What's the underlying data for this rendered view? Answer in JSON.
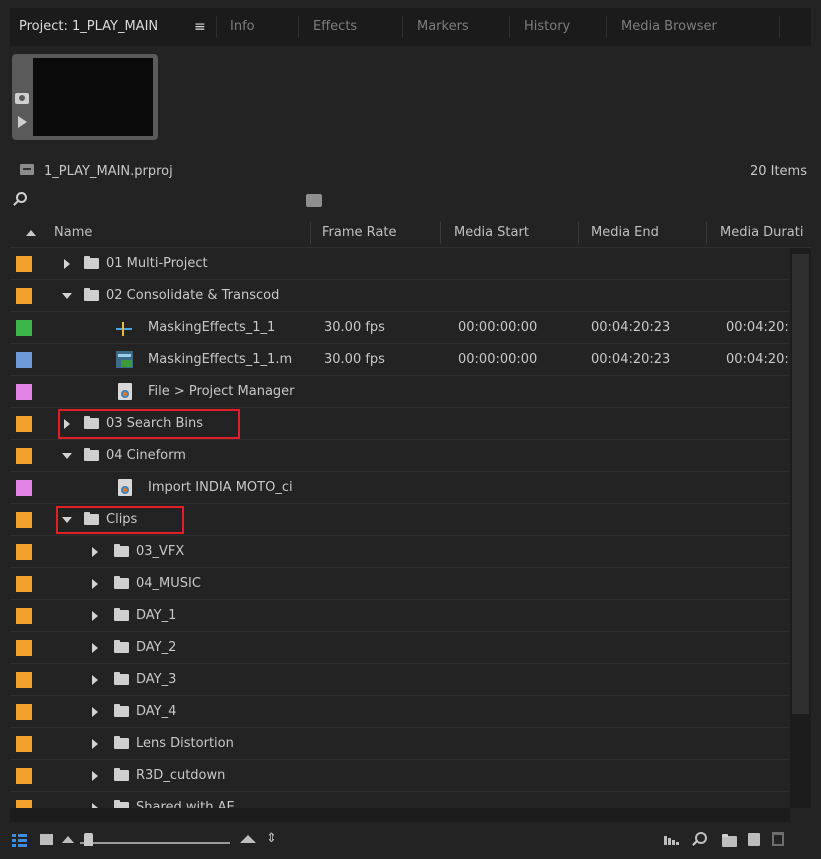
{
  "tabs": [
    {
      "label": "Project: 1_PLAY_MAIN",
      "active": true
    },
    {
      "label": "Info"
    },
    {
      "label": "Effects"
    },
    {
      "label": "Markers"
    },
    {
      "label": "History"
    },
    {
      "label": "Media Browser"
    }
  ],
  "panel_menu_glyph": "≡",
  "project": {
    "file_name": "1_PLAY_MAIN.prproj",
    "item_count": "20 Items"
  },
  "search": {
    "placeholder": ""
  },
  "columns": {
    "name": "Name",
    "frame_rate": "Frame Rate",
    "media_start": "Media Start",
    "media_end": "Media End",
    "media_duration": "Media Durati"
  },
  "rows": [
    {
      "name": "01 Multi-Project",
      "type": "folder",
      "expanded": false,
      "label_color": "#f2a12c"
    },
    {
      "name": "02 Consolidate & Transcod",
      "type": "folder",
      "expanded": true,
      "label_color": "#f2a12c"
    },
    {
      "name": "MaskingEffects_1_1",
      "type": "sequence",
      "label_color": "#3db54a",
      "frame_rate": "30.00 fps",
      "media_start": "00:00:00:00",
      "media_end": "00:04:20:23",
      "media_duration": "00:04:20:"
    },
    {
      "name": "MaskingEffects_1_1.m",
      "type": "video",
      "label_color": "#6e9ad7",
      "frame_rate": "30.00 fps",
      "media_start": "00:00:00:00",
      "media_end": "00:04:20:23",
      "media_duration": "00:04:20:"
    },
    {
      "name": "File > Project Manager",
      "type": "document",
      "label_color": "#e282e6"
    },
    {
      "name": "03 Search Bins",
      "type": "folder",
      "expanded": false,
      "label_color": "#f2a12c",
      "highlighted": true
    },
    {
      "name": "04 Cineform",
      "type": "folder",
      "expanded": true,
      "label_color": "#f2a12c"
    },
    {
      "name": "Import INDIA MOTO_ci",
      "type": "document",
      "label_color": "#e282e6"
    },
    {
      "name": "Clips",
      "type": "folder",
      "expanded": true,
      "label_color": "#f2a12c",
      "highlighted": true
    },
    {
      "name": "03_VFX",
      "type": "folder",
      "expanded": false,
      "label_color": "#f2a12c"
    },
    {
      "name": "04_MUSIC",
      "type": "folder",
      "expanded": false,
      "label_color": "#f2a12c"
    },
    {
      "name": "DAY_1",
      "type": "folder",
      "expanded": false,
      "label_color": "#f2a12c"
    },
    {
      "name": "DAY_2",
      "type": "folder",
      "expanded": false,
      "label_color": "#f2a12c"
    },
    {
      "name": "DAY_3",
      "type": "folder",
      "expanded": false,
      "label_color": "#f2a12c"
    },
    {
      "name": "DAY_4",
      "type": "folder",
      "expanded": false,
      "label_color": "#f2a12c"
    },
    {
      "name": "Lens Distortion",
      "type": "folder",
      "expanded": false,
      "label_color": "#f2a12c"
    },
    {
      "name": "R3D_cutdown",
      "type": "folder",
      "expanded": false,
      "label_color": "#f2a12c"
    },
    {
      "name": "Shared with AE",
      "type": "folder",
      "expanded": false,
      "label_color": "#f2a12c"
    }
  ],
  "toolbar": {
    "left": [
      "list-view-icon",
      "icon-view-icon",
      "freeform-view-icon",
      "zoom-slider",
      "sort-icons-icon"
    ],
    "right": [
      "automate-to-sequence-icon",
      "find-icon",
      "new-bin-icon",
      "new-item-icon",
      "clear-icon"
    ]
  },
  "highlight_color": "#e21f26"
}
